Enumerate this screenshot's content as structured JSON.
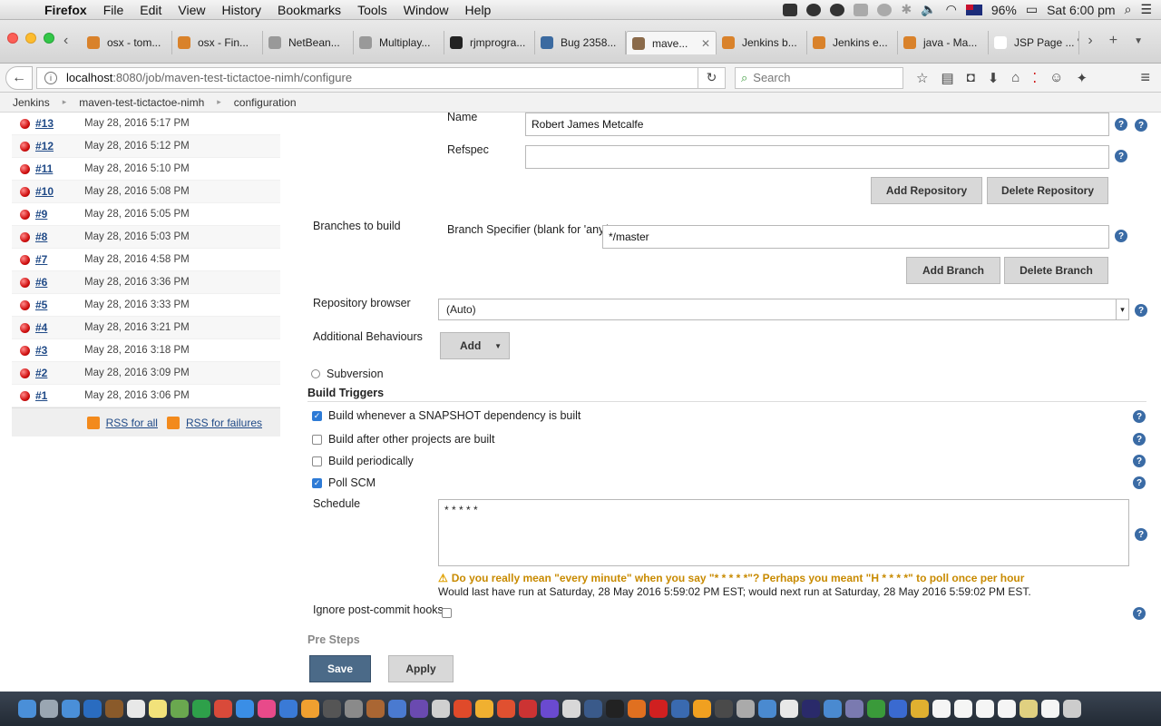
{
  "menubar": {
    "app": "Firefox",
    "items": [
      "File",
      "Edit",
      "View",
      "History",
      "Bookmarks",
      "Tools",
      "Window",
      "Help"
    ],
    "battery": "96%",
    "clock": "Sat 6:00 pm"
  },
  "tabs": [
    {
      "label": "osx - tom...",
      "color": "#d9822b"
    },
    {
      "label": "osx - Fin...",
      "color": "#d9822b"
    },
    {
      "label": "NetBean...",
      "color": "#999999"
    },
    {
      "label": "Multiplay...",
      "color": "#999999"
    },
    {
      "label": "rjmprogra...",
      "color": "#222222"
    },
    {
      "label": "Bug 2358...",
      "color": "#3b6aa0"
    },
    {
      "label": "mave...",
      "color": "#8a6a4a",
      "active": true
    },
    {
      "label": "Jenkins b...",
      "color": "#d9822b"
    },
    {
      "label": "Jenkins e...",
      "color": "#d9822b"
    },
    {
      "label": "java - Ma...",
      "color": "#d9822b"
    },
    {
      "label": "JSP Page ... \"...",
      "color": "#ffffff"
    }
  ],
  "navbar": {
    "url_host": "localhost",
    "url_path": ":8080/job/maven-test-tictactoe-nimh/configure",
    "search_placeholder": "Search"
  },
  "breadcrumbs": [
    "Jenkins",
    "maven-test-tictactoe-nimh",
    "configuration"
  ],
  "builds": [
    {
      "id": "#13",
      "date": "May 28, 2016 5:17 PM"
    },
    {
      "id": "#12",
      "date": "May 28, 2016 5:12 PM"
    },
    {
      "id": "#11",
      "date": "May 28, 2016 5:10 PM"
    },
    {
      "id": "#10",
      "date": "May 28, 2016 5:08 PM"
    },
    {
      "id": "#9",
      "date": "May 28, 2016 5:05 PM"
    },
    {
      "id": "#8",
      "date": "May 28, 2016 5:03 PM"
    },
    {
      "id": "#7",
      "date": "May 28, 2016 4:58 PM"
    },
    {
      "id": "#6",
      "date": "May 28, 2016 3:36 PM"
    },
    {
      "id": "#5",
      "date": "May 28, 2016 3:33 PM"
    },
    {
      "id": "#4",
      "date": "May 28, 2016 3:21 PM"
    },
    {
      "id": "#3",
      "date": "May 28, 2016 3:18 PM"
    },
    {
      "id": "#2",
      "date": "May 28, 2016 3:09 PM"
    },
    {
      "id": "#1",
      "date": "May 28, 2016 3:06 PM"
    }
  ],
  "rss": {
    "all": "RSS for all",
    "failures": "RSS for failures"
  },
  "scm": {
    "name_label": "Name",
    "name_value": "Robert James Metcalfe",
    "refspec_label": "Refspec",
    "refspec_value": "",
    "add_repo": "Add Repository",
    "delete_repo": "Delete Repository",
    "branches_label": "Branches to build",
    "branch_spec_label": "Branch Specifier (blank for 'any')",
    "branch_spec_value": "*/master",
    "add_branch": "Add Branch",
    "delete_branch": "Delete Branch",
    "repo_browser_label": "Repository browser",
    "repo_browser_value": "(Auto)",
    "additional_label": "Additional Behaviours",
    "add": "Add",
    "subversion": "Subversion"
  },
  "triggers": {
    "title": "Build Triggers",
    "snapshot": "Build whenever a SNAPSHOT dependency is built",
    "after_other": "Build after other projects are built",
    "periodically": "Build periodically",
    "poll_scm": "Poll SCM",
    "schedule_label": "Schedule",
    "schedule_value": "* * * * *",
    "warning": "Do you really mean \"every minute\" when you say \"* * * * *\"? Perhaps you meant \"H * * * *\" to poll once per hour",
    "next_run": "Would last have run at Saturday, 28 May 2016 5:59:02 PM EST; would next run at Saturday, 28 May 2016 5:59:02 PM EST.",
    "ignore_hooks": "Ignore post-commit hooks"
  },
  "pre_steps": "Pre Steps",
  "actions": {
    "save": "Save",
    "apply": "Apply"
  },
  "dock_colors": [
    "#4a8fd8",
    "#9aa6b2",
    "#4a8fd8",
    "#2a6cc0",
    "#8a5a2a",
    "#e8e8e8",
    "#f2e27a",
    "#6aa84f",
    "#2ea04a",
    "#d94a3a",
    "#3a8ee6",
    "#e84a8a",
    "#3a7ad6",
    "#f0a030",
    "#555555",
    "#8a8a8a",
    "#aa6633",
    "#4a7ad0",
    "#6a4ab0",
    "#d0d0d0",
    "#e04a2a",
    "#f0b030",
    "#e05030",
    "#cc3333",
    "#6a4ad0",
    "#d8d8d8",
    "#3a5a8a",
    "#222222",
    "#e07020",
    "#d02020",
    "#3a6ab0",
    "#f0a020",
    "#4a4a4a",
    "#aaaaaa",
    "#4a8ad0",
    "#e8e8e8",
    "#2a2a6a",
    "#4a8ad0",
    "#7a7ab0",
    "#3a9a3a",
    "#3a6ad0",
    "#e0b030",
    "#f5f5f5",
    "#f5f5f5",
    "#f5f5f5",
    "#f5f5f5",
    "#e0d080",
    "#f5f5f5",
    "#cccccc"
  ]
}
